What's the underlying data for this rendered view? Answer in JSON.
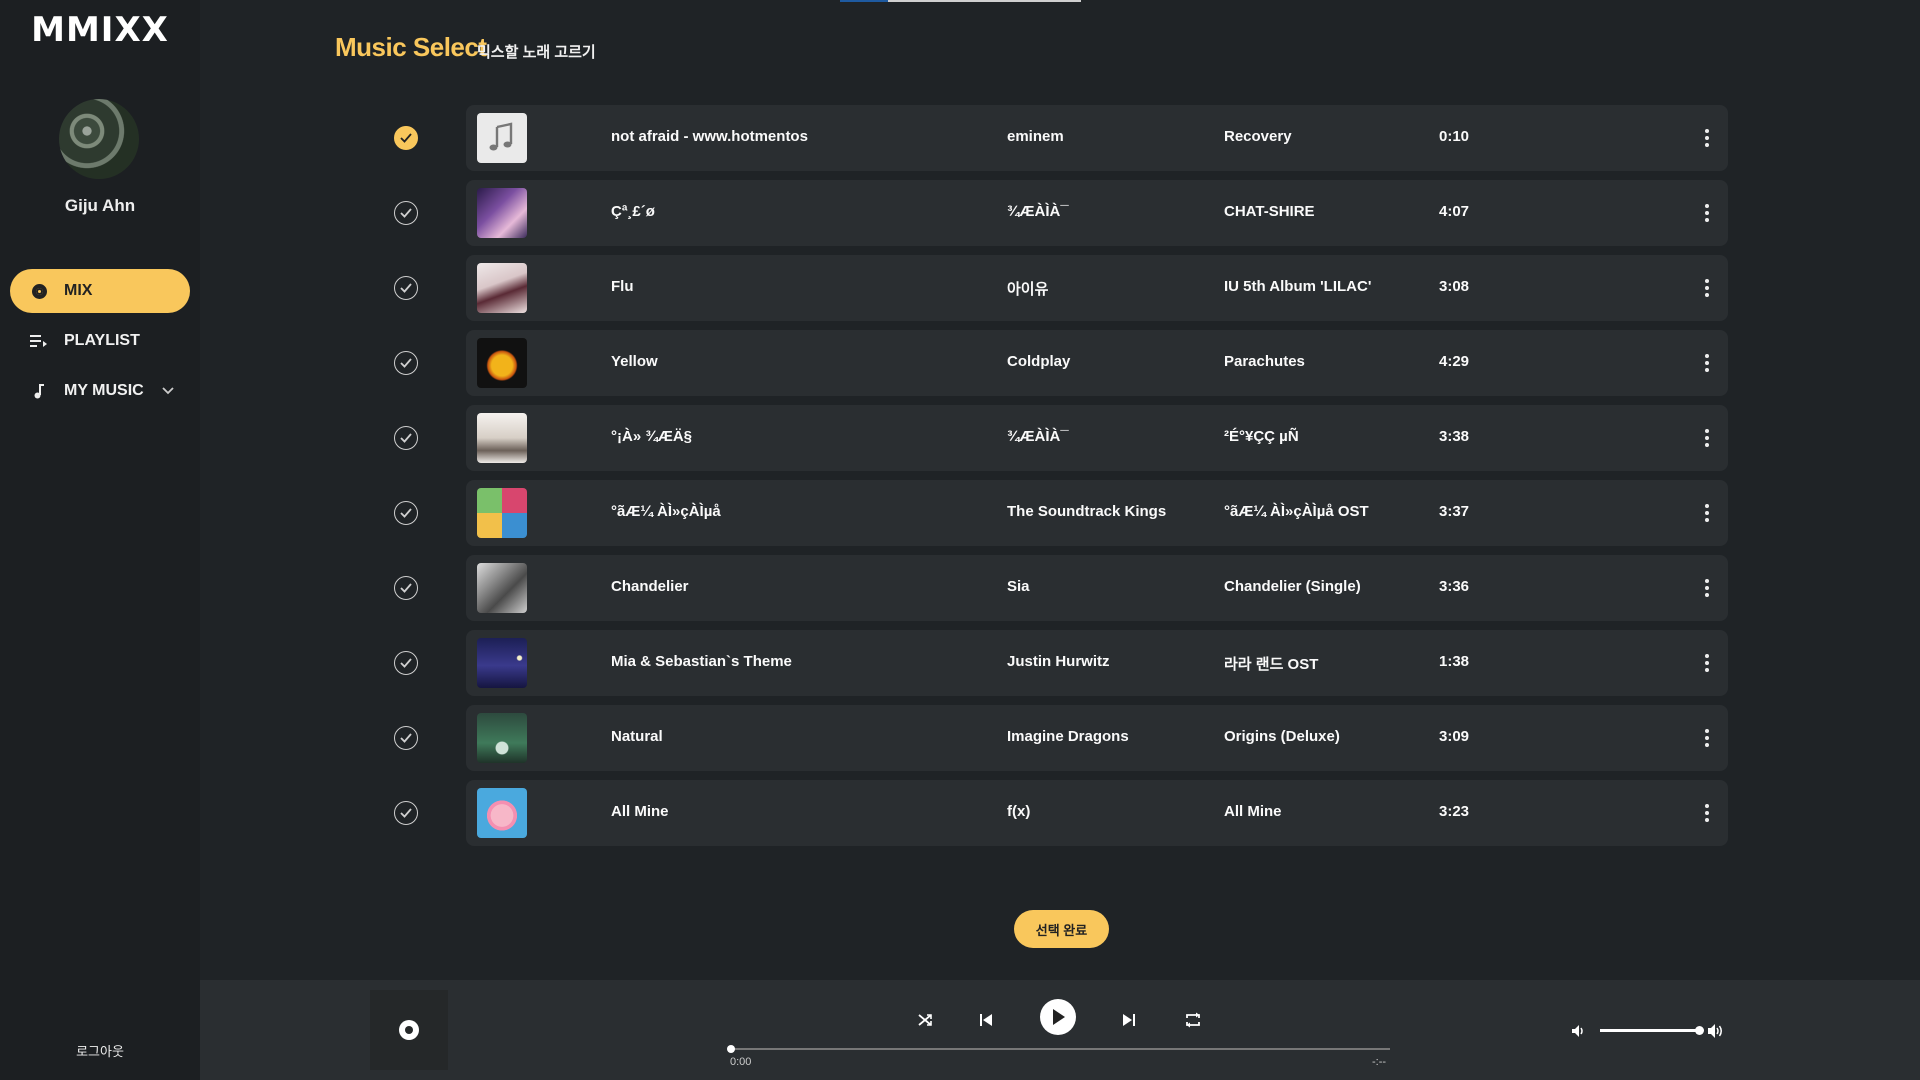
{
  "app": {
    "logo": "MMIXX"
  },
  "user": {
    "name": "Giju Ahn"
  },
  "nav": [
    {
      "label": "MIX",
      "icon": "disc-icon",
      "active": true
    },
    {
      "label": "PLAYLIST",
      "icon": "playlist-icon"
    },
    {
      "label": "MY MUSIC",
      "icon": "music-note-icon"
    }
  ],
  "logout_label": "로그아웃",
  "page": {
    "title": "Music Select",
    "subtitle": "믹스할 노래 고르기"
  },
  "songs": [
    {
      "title": "not afraid - www.hotmentos",
      "artist": "eminem",
      "album": "Recovery",
      "duration": "0:10",
      "selected": true
    },
    {
      "title": "Çª¸£´ø",
      "artist": "¾ÆÀÌÀ¯",
      "album": "CHAT-SHIRE",
      "duration": "4:07",
      "selected": false
    },
    {
      "title": "Flu",
      "artist": "아이유",
      "album": "IU 5th Album 'LILAC'",
      "duration": "3:08",
      "selected": false
    },
    {
      "title": "Yellow",
      "artist": "Coldplay",
      "album": "Parachutes",
      "duration": "4:29",
      "selected": false
    },
    {
      "title": "°¡À» ¾ÆÄ§",
      "artist": "¾ÆÀÌÀ¯",
      "album": "²É°¥ÇÇ µÑ",
      "duration": "3:38",
      "selected": false
    },
    {
      "title": "°ãÆ¼ ÀÌ»çÀÌµå",
      "artist": "The Soundtrack Kings",
      "album": "°ãÆ¼ ÀÌ»çÀÌµå OST",
      "duration": "3:37",
      "selected": false
    },
    {
      "title": "Chandelier",
      "artist": "Sia",
      "album": "Chandelier (Single)",
      "duration": "3:36",
      "selected": false
    },
    {
      "title": "Mia & Sebastian`s Theme",
      "artist": "Justin Hurwitz",
      "album": "라라 랜드 OST",
      "duration": "1:38",
      "selected": false
    },
    {
      "title": "Natural",
      "artist": "Imagine Dragons",
      "album": "Origins (Deluxe)",
      "duration": "3:09",
      "selected": false
    },
    {
      "title": "All Mine",
      "artist": "f(x)",
      "album": "All Mine",
      "duration": "3:23",
      "selected": false
    }
  ],
  "done_button": "선택 완료",
  "player": {
    "current_time": "0:00",
    "total_time": "-:--",
    "progress": 0,
    "volume": 1.0
  },
  "colors": {
    "accent": "#f9c75c",
    "background": "#1f2326",
    "sidebar": "#1c1f22",
    "row": "#2a2e31"
  }
}
